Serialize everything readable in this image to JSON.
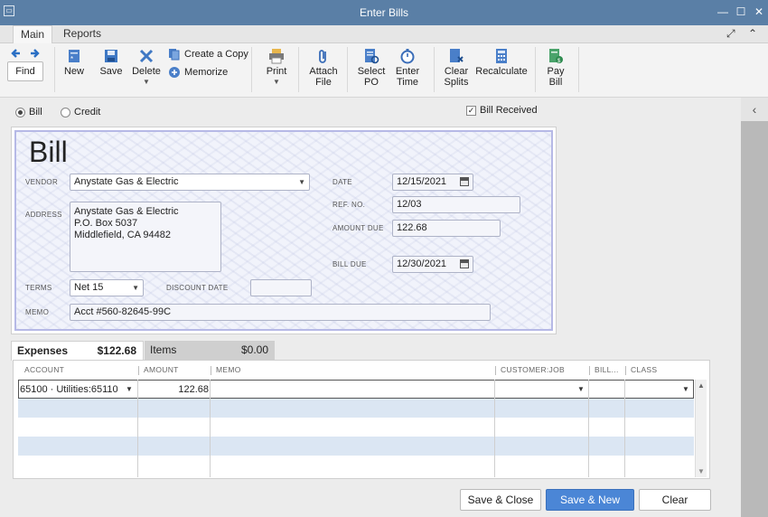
{
  "window": {
    "title": "Enter Bills"
  },
  "tabs": [
    {
      "label": "Main"
    },
    {
      "label": "Reports"
    }
  ],
  "toolbar": {
    "find": "Find",
    "new": "New",
    "save": "Save",
    "delete": "Delete",
    "create_copy": "Create a Copy",
    "memorize": "Memorize",
    "print": "Print",
    "attach_file": [
      "Attach",
      "File"
    ],
    "select_po": [
      "Select",
      "PO"
    ],
    "enter_time": [
      "Enter",
      "Time"
    ],
    "clear_splits": [
      "Clear",
      "Splits"
    ],
    "recalculate": "Recalculate",
    "pay_bill": [
      "Pay",
      "Bill"
    ]
  },
  "options": {
    "bill": "Bill",
    "credit": "Credit",
    "bill_received": "Bill Received"
  },
  "form": {
    "title": "Bill",
    "vendor_label": "VENDOR",
    "vendor": "Anystate Gas & Electric",
    "address_label": "ADDRESS",
    "address_lines": [
      "Anystate Gas & Electric",
      "P.O. Box 5037",
      "Middlefield, CA 94482"
    ],
    "date_label": "DATE",
    "date": "12/15/2021",
    "ref_label": "REF. NO.",
    "ref": "12/03",
    "amount_due_label": "AMOUNT DUE",
    "amount_due": "122.68",
    "bill_due_label": "BILL DUE",
    "bill_due": "12/30/2021",
    "terms_label": "TERMS",
    "terms": "Net 15",
    "discount_date_label": "DISCOUNT DATE",
    "discount_date": "",
    "memo_label": "MEMO",
    "memo": "Acct #560-82645-99C"
  },
  "subtabs": {
    "expenses_label": "Expenses",
    "expenses_amount": "$122.68",
    "items_label": "Items",
    "items_amount": "$0.00"
  },
  "grid": {
    "headers": {
      "account": "ACCOUNT",
      "amount": "AMOUNT",
      "memo": "MEMO",
      "customer_job": "CUSTOMER:JOB",
      "billable": "BILL...",
      "class": "CLASS"
    },
    "rows": [
      {
        "account": "65100 · Utilities:65110",
        "amount": "122.68",
        "memo": "",
        "customer_job": "",
        "billable": "",
        "class": ""
      }
    ]
  },
  "buttons": {
    "save_close": "Save & Close",
    "save_new": "Save & New",
    "clear": "Clear"
  }
}
